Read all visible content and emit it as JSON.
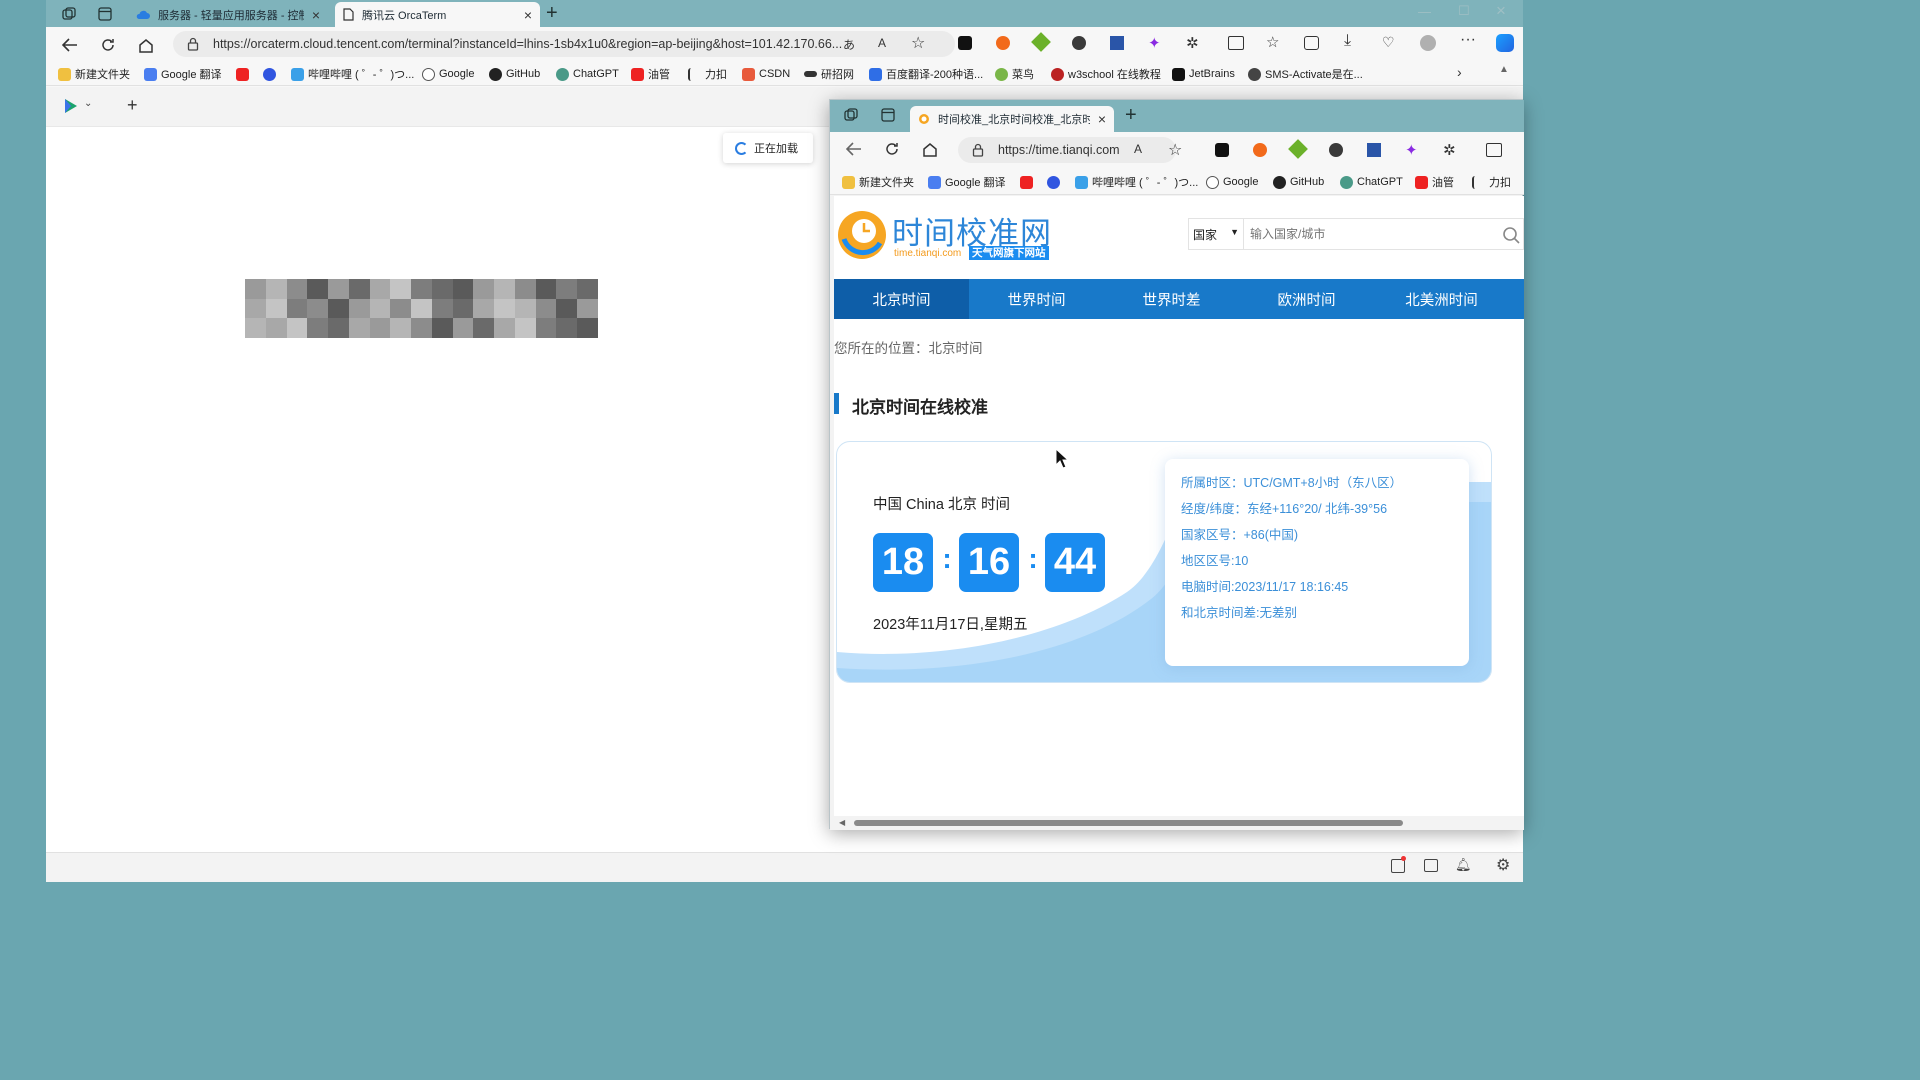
{
  "browser": {
    "tabs": [
      {
        "title": "服务器 - 轻量应用服务器 - 控制台",
        "active": false
      },
      {
        "title": "腾讯云 OrcaTerm",
        "active": true
      }
    ],
    "url": "https://orcaterm.cloud.tencent.com/terminal?instanceId=lhins-1sb4x1u0&region=ap-beijing&host=101.42.170.66...",
    "favorites": [
      {
        "label": "新建文件夹",
        "icon": "folder-icon",
        "color": "#f0c040"
      },
      {
        "label": "Google 翻译",
        "icon": "translate-icon",
        "color": "#4a7ef0"
      },
      {
        "label": "",
        "icon": "red-square-icon",
        "color": "#e22"
      },
      {
        "label": "",
        "icon": "baidu-icon",
        "color": "#3055e0"
      },
      {
        "label": "哔哩哔哩 ( ゜- ゜)つ...",
        "icon": "bilibili-icon",
        "color": "#3aa0e8"
      },
      {
        "label": "Google",
        "icon": "google-icon",
        "color": "#555"
      },
      {
        "label": "GitHub",
        "icon": "github-icon",
        "color": "#222"
      },
      {
        "label": "ChatGPT",
        "icon": "chatgpt-icon",
        "color": "#4a9a88"
      },
      {
        "label": "油管",
        "icon": "youtube-icon",
        "color": "#e22"
      },
      {
        "label": "力扣",
        "icon": "leetcode-icon",
        "color": "#333"
      },
      {
        "label": "CSDN",
        "icon": "csdn-icon",
        "color": "#e85a3c"
      },
      {
        "label": "研招网",
        "icon": "yanzhao-icon",
        "color": "#333"
      },
      {
        "label": "百度翻译-200种语...",
        "icon": "baidu-translate-icon",
        "color": "#2f6ee6"
      },
      {
        "label": "菜鸟",
        "icon": "runoob-icon",
        "color": "#7ab648"
      },
      {
        "label": "w3school 在线教程",
        "icon": "w3school-icon",
        "color": "#b22"
      },
      {
        "label": "JetBrains",
        "icon": "jetbrains-icon",
        "color": "#111"
      },
      {
        "label": "SMS-Activate是在...",
        "icon": "sms-icon",
        "color": "#444"
      }
    ],
    "loading_text": "正在加载"
  },
  "popup": {
    "tab_title": "时间校准_北京时间校准_北京时间",
    "url": "https://time.tianqi.com",
    "favorites": [
      {
        "label": "新建文件夹",
        "icon": "folder-icon",
        "color": "#f0c040"
      },
      {
        "label": "Google 翻译",
        "icon": "translate-icon",
        "color": "#4a7ef0"
      },
      {
        "label": "",
        "icon": "red-square-icon",
        "color": "#e22"
      },
      {
        "label": "",
        "icon": "baidu-icon",
        "color": "#3055e0"
      },
      {
        "label": "哔哩哔哩 ( ゜- ゜)つ...",
        "icon": "bilibili-icon",
        "color": "#3aa0e8"
      },
      {
        "label": "Google",
        "icon": "google-icon",
        "color": "#555"
      },
      {
        "label": "GitHub",
        "icon": "github-icon",
        "color": "#222"
      },
      {
        "label": "ChatGPT",
        "icon": "chatgpt-icon",
        "color": "#4a9a88"
      },
      {
        "label": "油管",
        "icon": "youtube-icon",
        "color": "#e22"
      },
      {
        "label": "力扣",
        "icon": "leetcode-icon",
        "color": "#333"
      }
    ]
  },
  "site": {
    "logo_title": "时间校准网",
    "logo_domain": "time.tianqi.com",
    "logo_badge": "天气网旗下网站",
    "search_scope": "国家",
    "search_placeholder": "输入国家/城市",
    "nav": [
      {
        "label": "北京时间",
        "selected": true
      },
      {
        "label": "世界时间",
        "selected": false
      },
      {
        "label": "世界时差",
        "selected": false
      },
      {
        "label": "欧洲时间",
        "selected": false
      },
      {
        "label": "北美洲时间",
        "selected": false
      }
    ],
    "breadcrumb": "您所在的位置：北京时间",
    "section_title": "北京时间在线校准",
    "clock": {
      "location": "中国 China 北京 时间",
      "hours": "18",
      "minutes": "16",
      "seconds": "44",
      "date": "2023年11月17日,星期五"
    },
    "info": [
      "所属时区：UTC/GMT+8小时（东八区）",
      "经度/纬度：东经+116°20/ 北纬-39°56",
      "国家区号：+86(中国)",
      "地区区号:10",
      "电脑时间:2023/11/17 18:16:45",
      "和北京时间差:无差别"
    ],
    "accent_color": "#1879c9",
    "digit_color": "#1a8cf0"
  }
}
